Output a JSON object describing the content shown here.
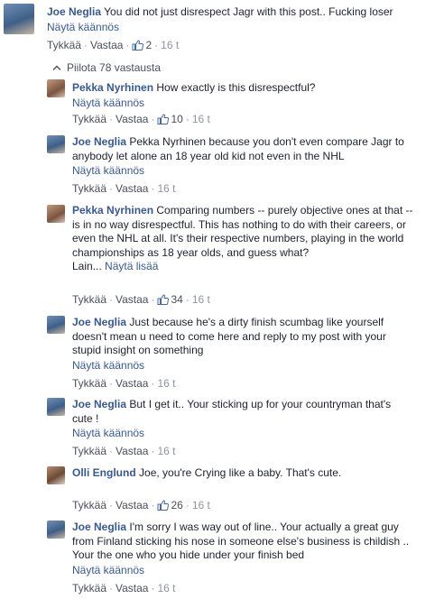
{
  "top_comment": {
    "author": "Joe Neglia",
    "text": "You did not just disrespect Jagr with this post.. Fucking loser",
    "translate": "Näytä käännös",
    "like": "Tykkää",
    "reply": "Vastaa",
    "likes": "2",
    "time": "16 t"
  },
  "hide_replies": "Piilota 78 vastausta",
  "replies": [
    {
      "author": "Pekka Nyrhinen",
      "text": "How exactly is this disrespectful?",
      "translate": "Näytä käännös",
      "like": "Tykkää",
      "reply": "Vastaa",
      "likes": "10",
      "time": "16 t"
    },
    {
      "author": "Joe Neglia",
      "text": "Pekka Nyrhinen because you don't even compare Jagr to anybody let alone an 18 year old kid not even in the NHL",
      "translate": "Näytä käännös",
      "like": "Tykkää",
      "reply": "Vastaa",
      "likes": "",
      "time": "16 t"
    },
    {
      "author": "Pekka Nyrhinen",
      "text": "Comparing numbers -- purely objective ones at that -- is in no way disrespectful. This has nothing to do with their careers, or even the NHL at all. It's their respective numbers, playing in the world championships as 18 year olds, and guess what?",
      "truncated": "Lain...",
      "more": "Näytä lisää",
      "like": "Tykkää",
      "reply": "Vastaa",
      "likes": "34",
      "time": "16 t"
    },
    {
      "author": "Joe Neglia",
      "text": "Just because he's a dirty finish scumbag like yourself doesn't mean u need to come here and reply to my post with your stupid insight on something",
      "translate": "Näytä käännös",
      "like": "Tykkää",
      "reply": "Vastaa",
      "likes": "",
      "time": "16 t"
    },
    {
      "author": "Joe Neglia",
      "text": "But I get it.. Your sticking up for your countryman that's cute !",
      "translate": "Näytä käännös",
      "like": "Tykkää",
      "reply": "Vastaa",
      "likes": "",
      "time": "16 t"
    },
    {
      "author": "Olli Englund",
      "text": "Joe, you're Crying like a baby. That's cute.",
      "like": "Tykkää",
      "reply": "Vastaa",
      "likes": "26",
      "time": "16 t"
    },
    {
      "author": "Joe Neglia",
      "text": "I'm sorry I was way out of line.. Your actually a great guy from Finland sticking his nose in someone else's business is childish .. Your the one who you hide under your finish bed",
      "translate": "Näytä käännös",
      "like": "Tykkää",
      "reply": "Vastaa",
      "likes": "",
      "time": "16 t"
    }
  ],
  "colors": {
    "link": "#365899",
    "meta": "#90949c",
    "text": "#1d2129",
    "like_blue": "#4267b2"
  }
}
